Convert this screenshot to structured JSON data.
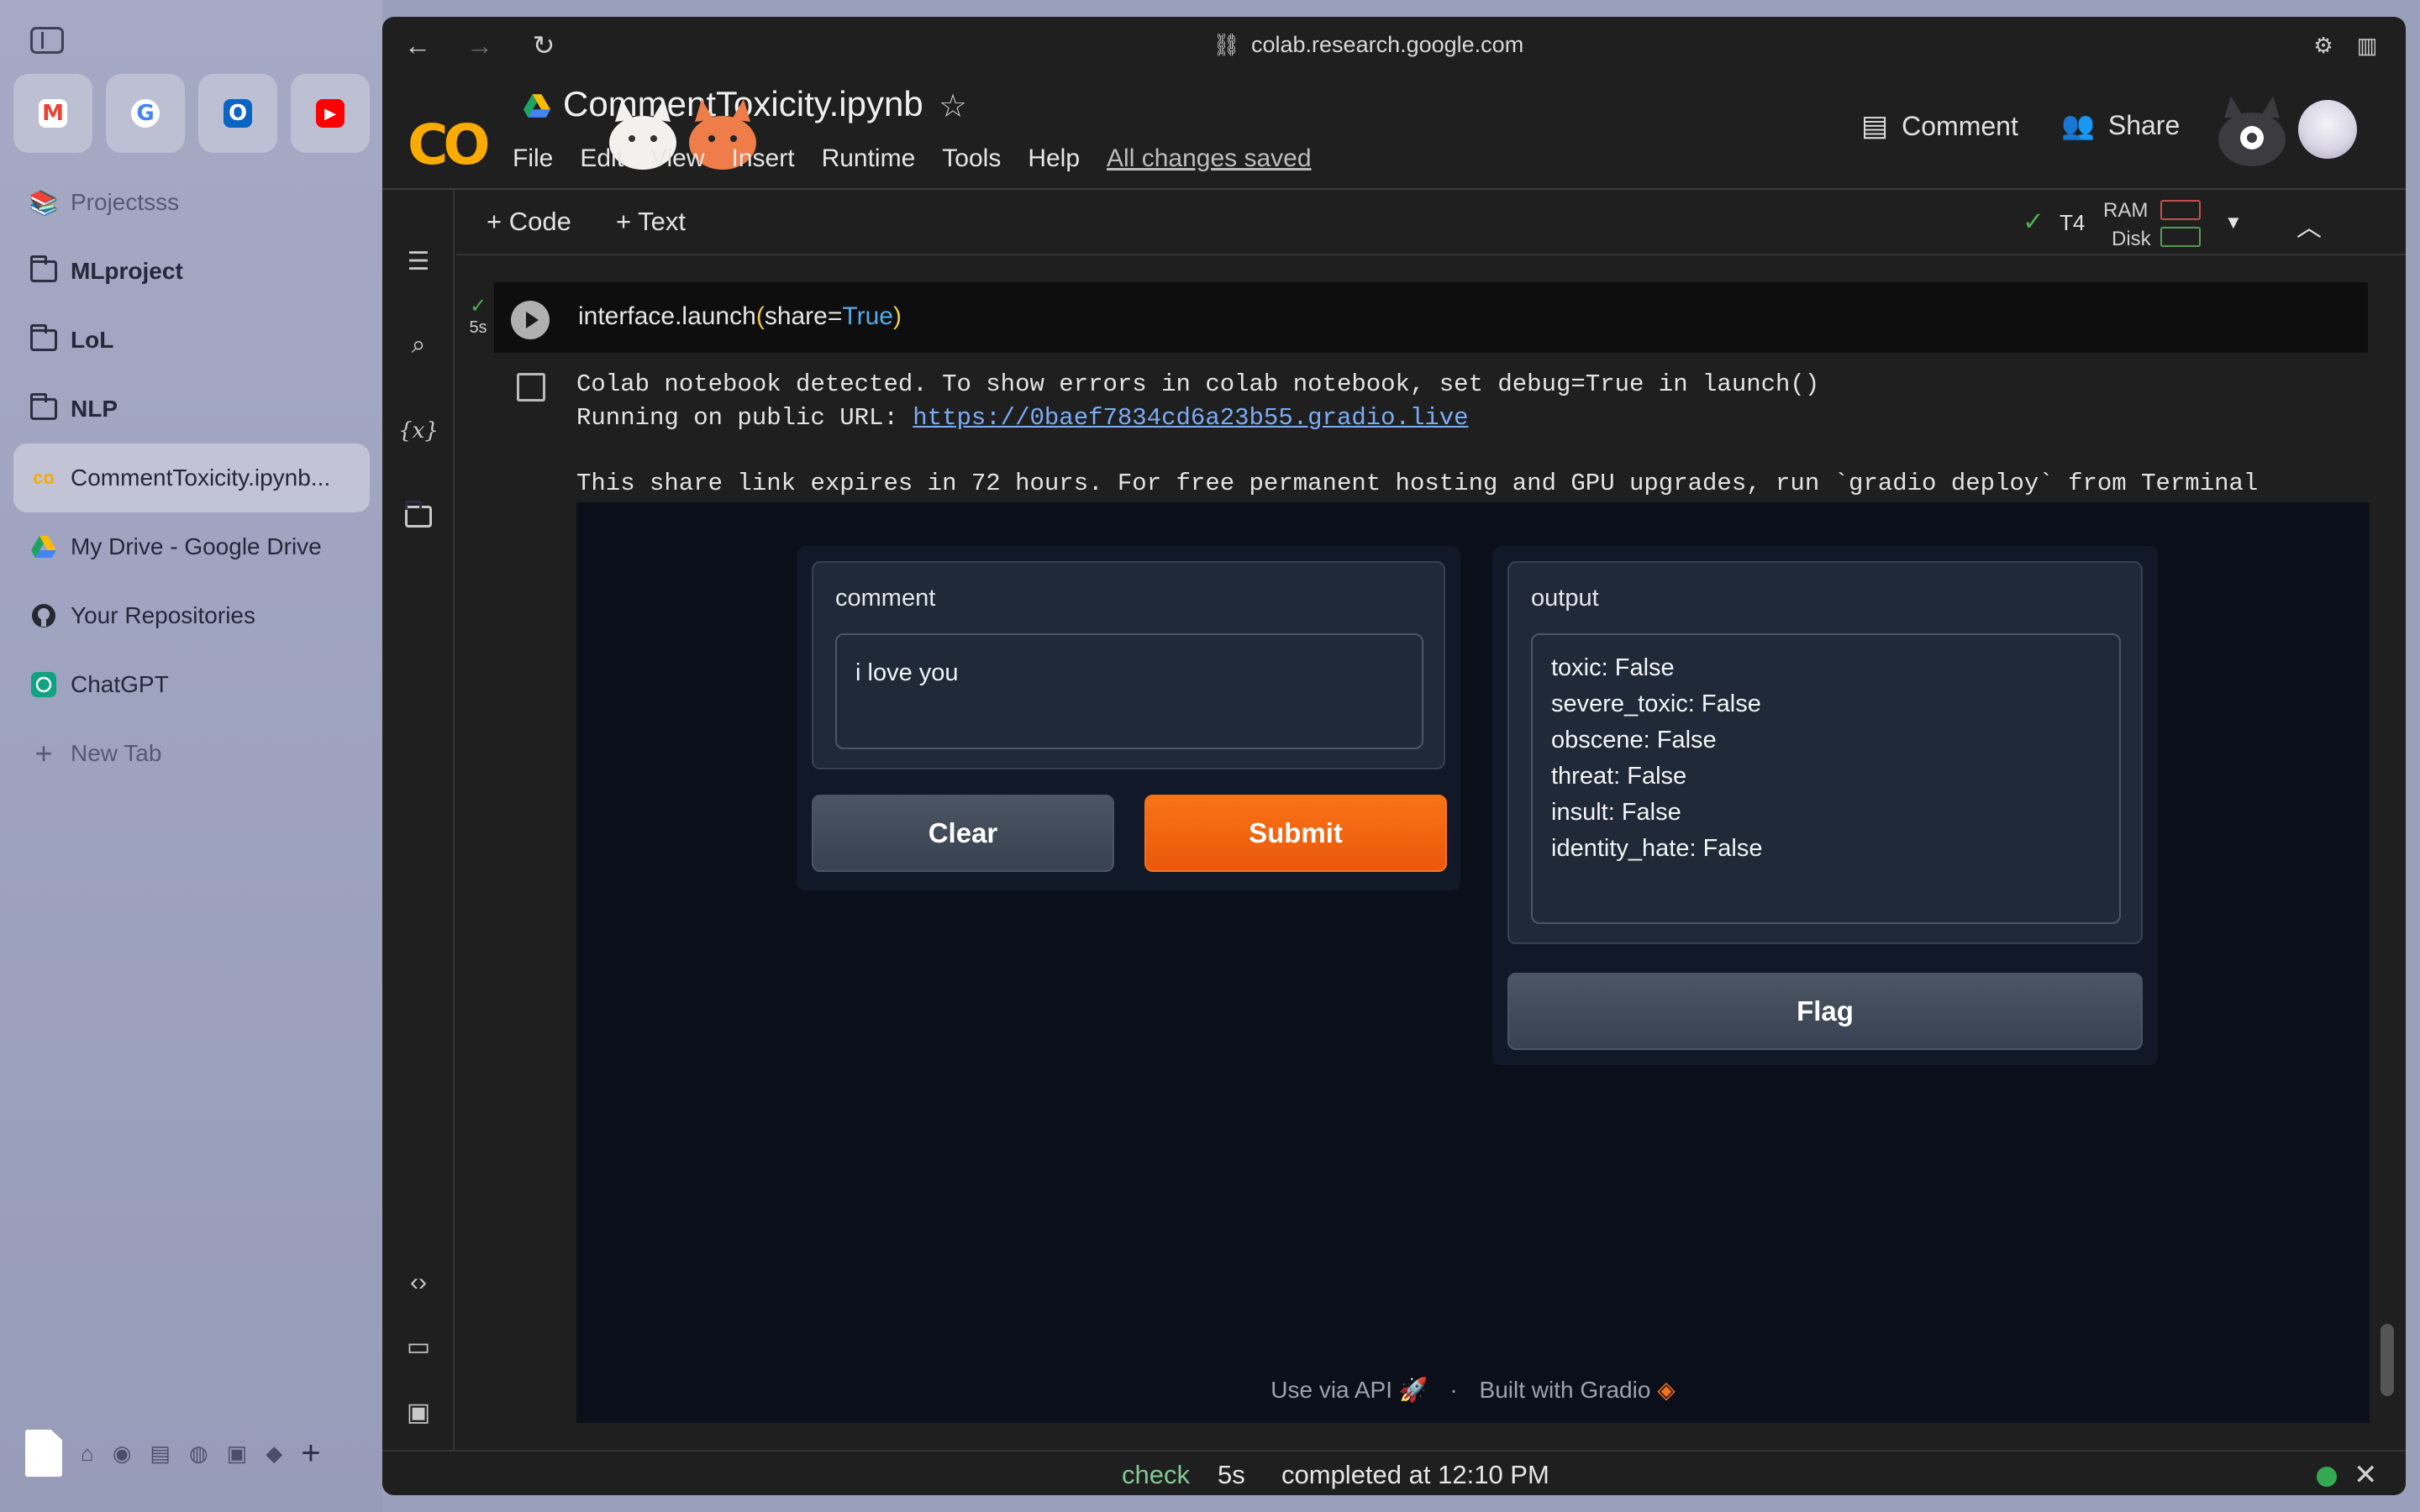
{
  "sidebar": {
    "favorites": [
      {
        "name": "gmail",
        "glyph": "M",
        "color": "#ea4335"
      },
      {
        "name": "google",
        "glyph": "G",
        "color": "#4285f4"
      },
      {
        "name": "outlook",
        "glyph": "O",
        "color": "#0a64c4"
      },
      {
        "name": "youtube",
        "glyph": "▶",
        "color": "#ff0000"
      }
    ],
    "items": [
      {
        "label": "Projectsss",
        "icon": "books-icon",
        "style": "muted"
      },
      {
        "label": "MLproject",
        "icon": "folder-icon",
        "style": "bold"
      },
      {
        "label": "LoL",
        "icon": "folder-icon",
        "style": "bold"
      },
      {
        "label": "NLP",
        "icon": "folder-icon",
        "style": "bold"
      },
      {
        "label": "CommentToxicity.ipynb...",
        "icon": "colab-icon",
        "style": "active"
      },
      {
        "label": "My Drive - Google Drive",
        "icon": "drive-icon",
        "style": ""
      },
      {
        "label": "Your Repositories",
        "icon": "github-icon",
        "style": ""
      },
      {
        "label": "ChatGPT",
        "icon": "chatgpt-icon",
        "style": ""
      },
      {
        "label": "New Tab",
        "icon": "plus-icon",
        "style": "muted"
      }
    ]
  },
  "browser": {
    "url": "colab.research.google.com"
  },
  "colab": {
    "logo": "CO",
    "title": "CommentToxicity.ipynb",
    "menu": [
      "File",
      "Edit",
      "View",
      "Insert",
      "Runtime",
      "Tools",
      "Help"
    ],
    "saved_status": "All changes saved",
    "comment_label": "Comment",
    "share_label": "Share",
    "add_code": "+ Code",
    "add_text": "+ Text",
    "runtime": "T4",
    "ram_label": "RAM",
    "disk_label": "Disk"
  },
  "cell": {
    "exec_time": "5s",
    "code_fn": "interface.launch",
    "code_open": "(",
    "code_arg": "share=",
    "code_val": "True",
    "code_close": ")"
  },
  "output": {
    "line1": "Colab notebook detected. To show errors in colab notebook, set debug=True in launch()",
    "line2_prefix": "Running on public URL: ",
    "line2_link": "https://0baef7834cd6a23b55.gradio.live",
    "line3": "This share link expires in 72 hours. For free permanent hosting and GPU upgrades, run `gradio deploy` from Terminal"
  },
  "gradio": {
    "input_label": "comment",
    "input_value": "i love you",
    "clear_label": "Clear",
    "submit_label": "Submit",
    "output_label": "output",
    "output_lines": [
      "toxic: False",
      "severe_toxic: False",
      "obscene: False",
      "threat: False",
      "insult: False",
      "identity_hate: False"
    ],
    "flag_label": "Flag",
    "footer_api": "Use via API",
    "footer_sep": "·",
    "footer_built": "Built with Gradio"
  },
  "status": {
    "check": "check",
    "time": "5s",
    "completed": "completed at 12:10 PM"
  }
}
